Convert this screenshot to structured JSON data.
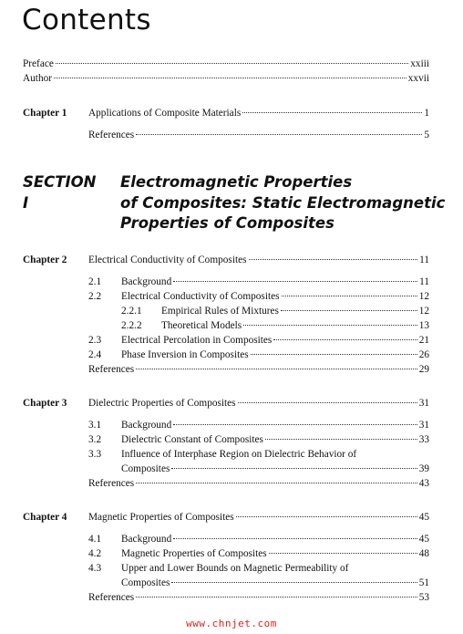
{
  "title": "Contents",
  "front_matter": [
    {
      "label": "Preface",
      "page": "xxiii"
    },
    {
      "label": "Author",
      "page": "xxvii"
    }
  ],
  "chapter1": {
    "label": "Chapter 1",
    "title": "Applications of Composite Materials",
    "page": "1",
    "references": {
      "label": "References",
      "page": "5"
    }
  },
  "section": {
    "label": "SECTION I",
    "lines": [
      "Electromagnetic Properties",
      "of Composites: Static Electromagnetic",
      "Properties of Composites"
    ]
  },
  "chapters": [
    {
      "label": "Chapter 2",
      "title": "Electrical Conductivity of Composites",
      "page": "11",
      "entries": [
        {
          "num": "2.1",
          "title": "Background",
          "page": "11",
          "level": 1
        },
        {
          "num": "2.2",
          "title": "Electrical Conductivity of Composites",
          "page": "12",
          "level": 1
        },
        {
          "num": "2.2.1",
          "title": "Empirical Rules of Mixtures",
          "page": "12",
          "level": 2
        },
        {
          "num": "2.2.2",
          "title": "Theoretical Models",
          "page": "13",
          "level": 2
        },
        {
          "num": "2.3",
          "title": "Electrical Percolation in Composites",
          "page": "21",
          "level": 1
        },
        {
          "num": "2.4",
          "title": "Phase Inversion in Composites",
          "page": "26",
          "level": 1
        }
      ],
      "references": {
        "label": "References",
        "page": "29"
      }
    },
    {
      "label": "Chapter 3",
      "title": "Dielectric Properties of Composites",
      "page": "31",
      "entries": [
        {
          "num": "3.1",
          "title": "Background",
          "page": "31",
          "level": 1
        },
        {
          "num": "3.2",
          "title": "Dielectric Constant of Composites",
          "page": "33",
          "level": 1
        },
        {
          "num": "3.3",
          "title": "Influence of Interphase Region on Dielectric Behavior of",
          "title_cont": "Composites",
          "page": "39",
          "level": 1
        }
      ],
      "references": {
        "label": "References",
        "page": "43"
      }
    },
    {
      "label": "Chapter 4",
      "title": "Magnetic Properties of Composites",
      "page": "45",
      "entries": [
        {
          "num": "4.1",
          "title": "Background",
          "page": "45",
          "level": 1
        },
        {
          "num": "4.2",
          "title": "Magnetic Properties of Composites",
          "page": "48",
          "level": 1
        },
        {
          "num": "4.3",
          "title": "Upper and Lower Bounds on Magnetic Permeability of",
          "title_cont": "Composites",
          "page": "51",
          "level": 1
        }
      ],
      "references": {
        "label": "References",
        "page": "53"
      }
    }
  ],
  "watermark": "www.chnjet.com"
}
